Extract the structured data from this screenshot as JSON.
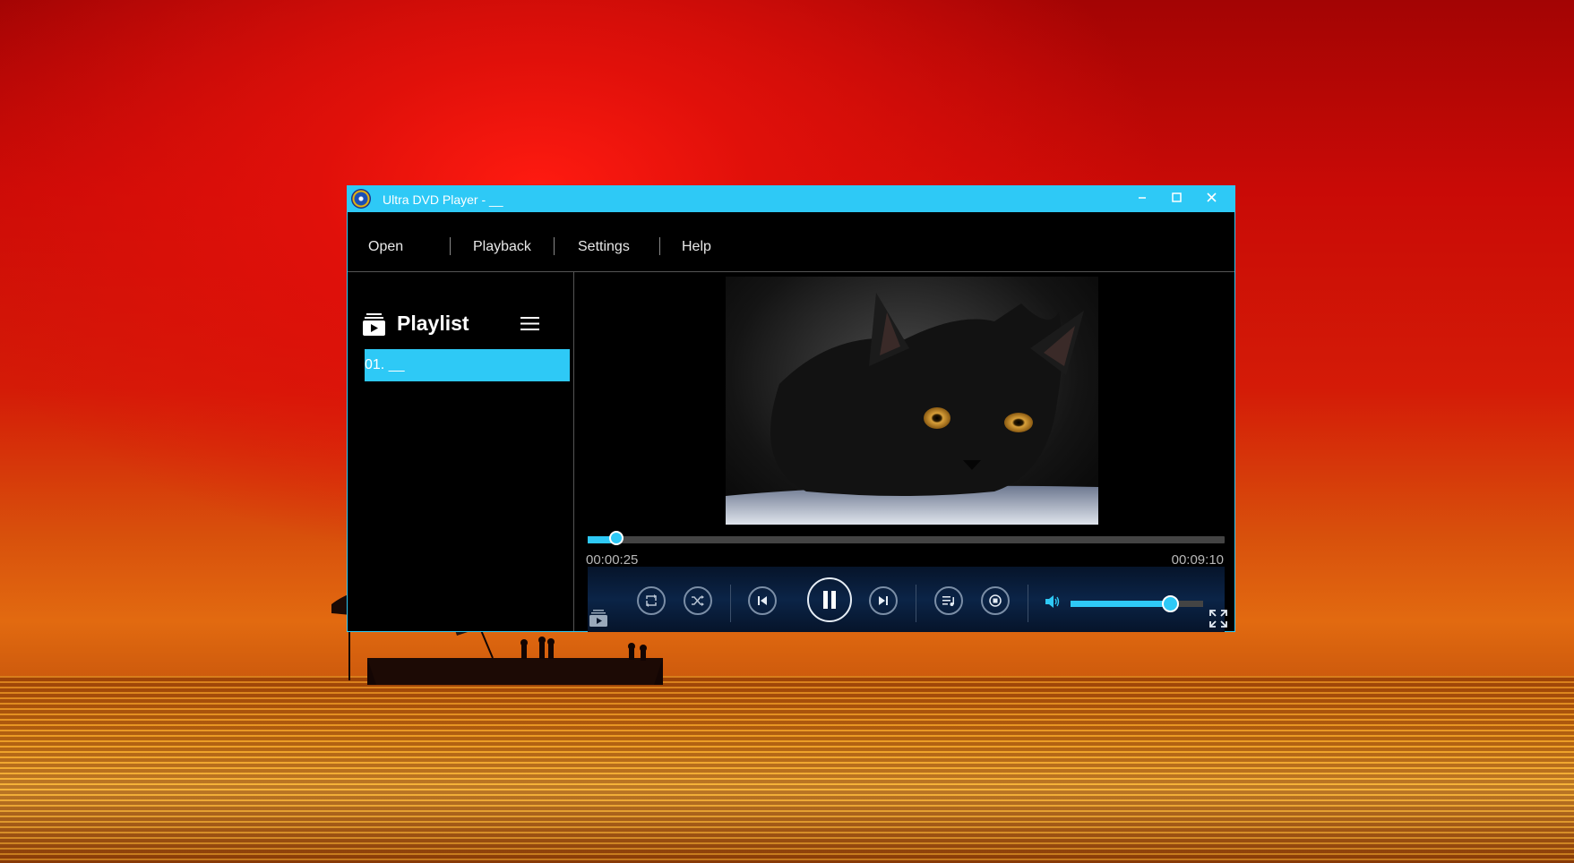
{
  "window": {
    "title": "Ultra DVD Player - __",
    "controls": {
      "minimize": "–",
      "maximize": "□",
      "close": "✕"
    }
  },
  "menu": {
    "items": [
      "Open",
      "Playback",
      "Settings",
      "Help"
    ]
  },
  "playlist": {
    "title": "Playlist",
    "items": [
      {
        "label": "01. __",
        "selected": true
      }
    ]
  },
  "player": {
    "current_time": "00:00:25",
    "total_time": "00:09:10",
    "progress_fraction": 0.0455,
    "volume_fraction": 0.75,
    "state": "playing"
  },
  "colors": {
    "accent": "#2ec9f6",
    "background": "#000000"
  },
  "icons": [
    "app-logo-icon",
    "playlist-icon",
    "hamburger-menu-icon",
    "repeat-icon",
    "shuffle-icon",
    "previous-icon",
    "pause-icon",
    "next-icon",
    "playlist-toggle-icon",
    "stop-icon",
    "volume-icon",
    "fullscreen-icon",
    "mini-playlist-icon"
  ]
}
